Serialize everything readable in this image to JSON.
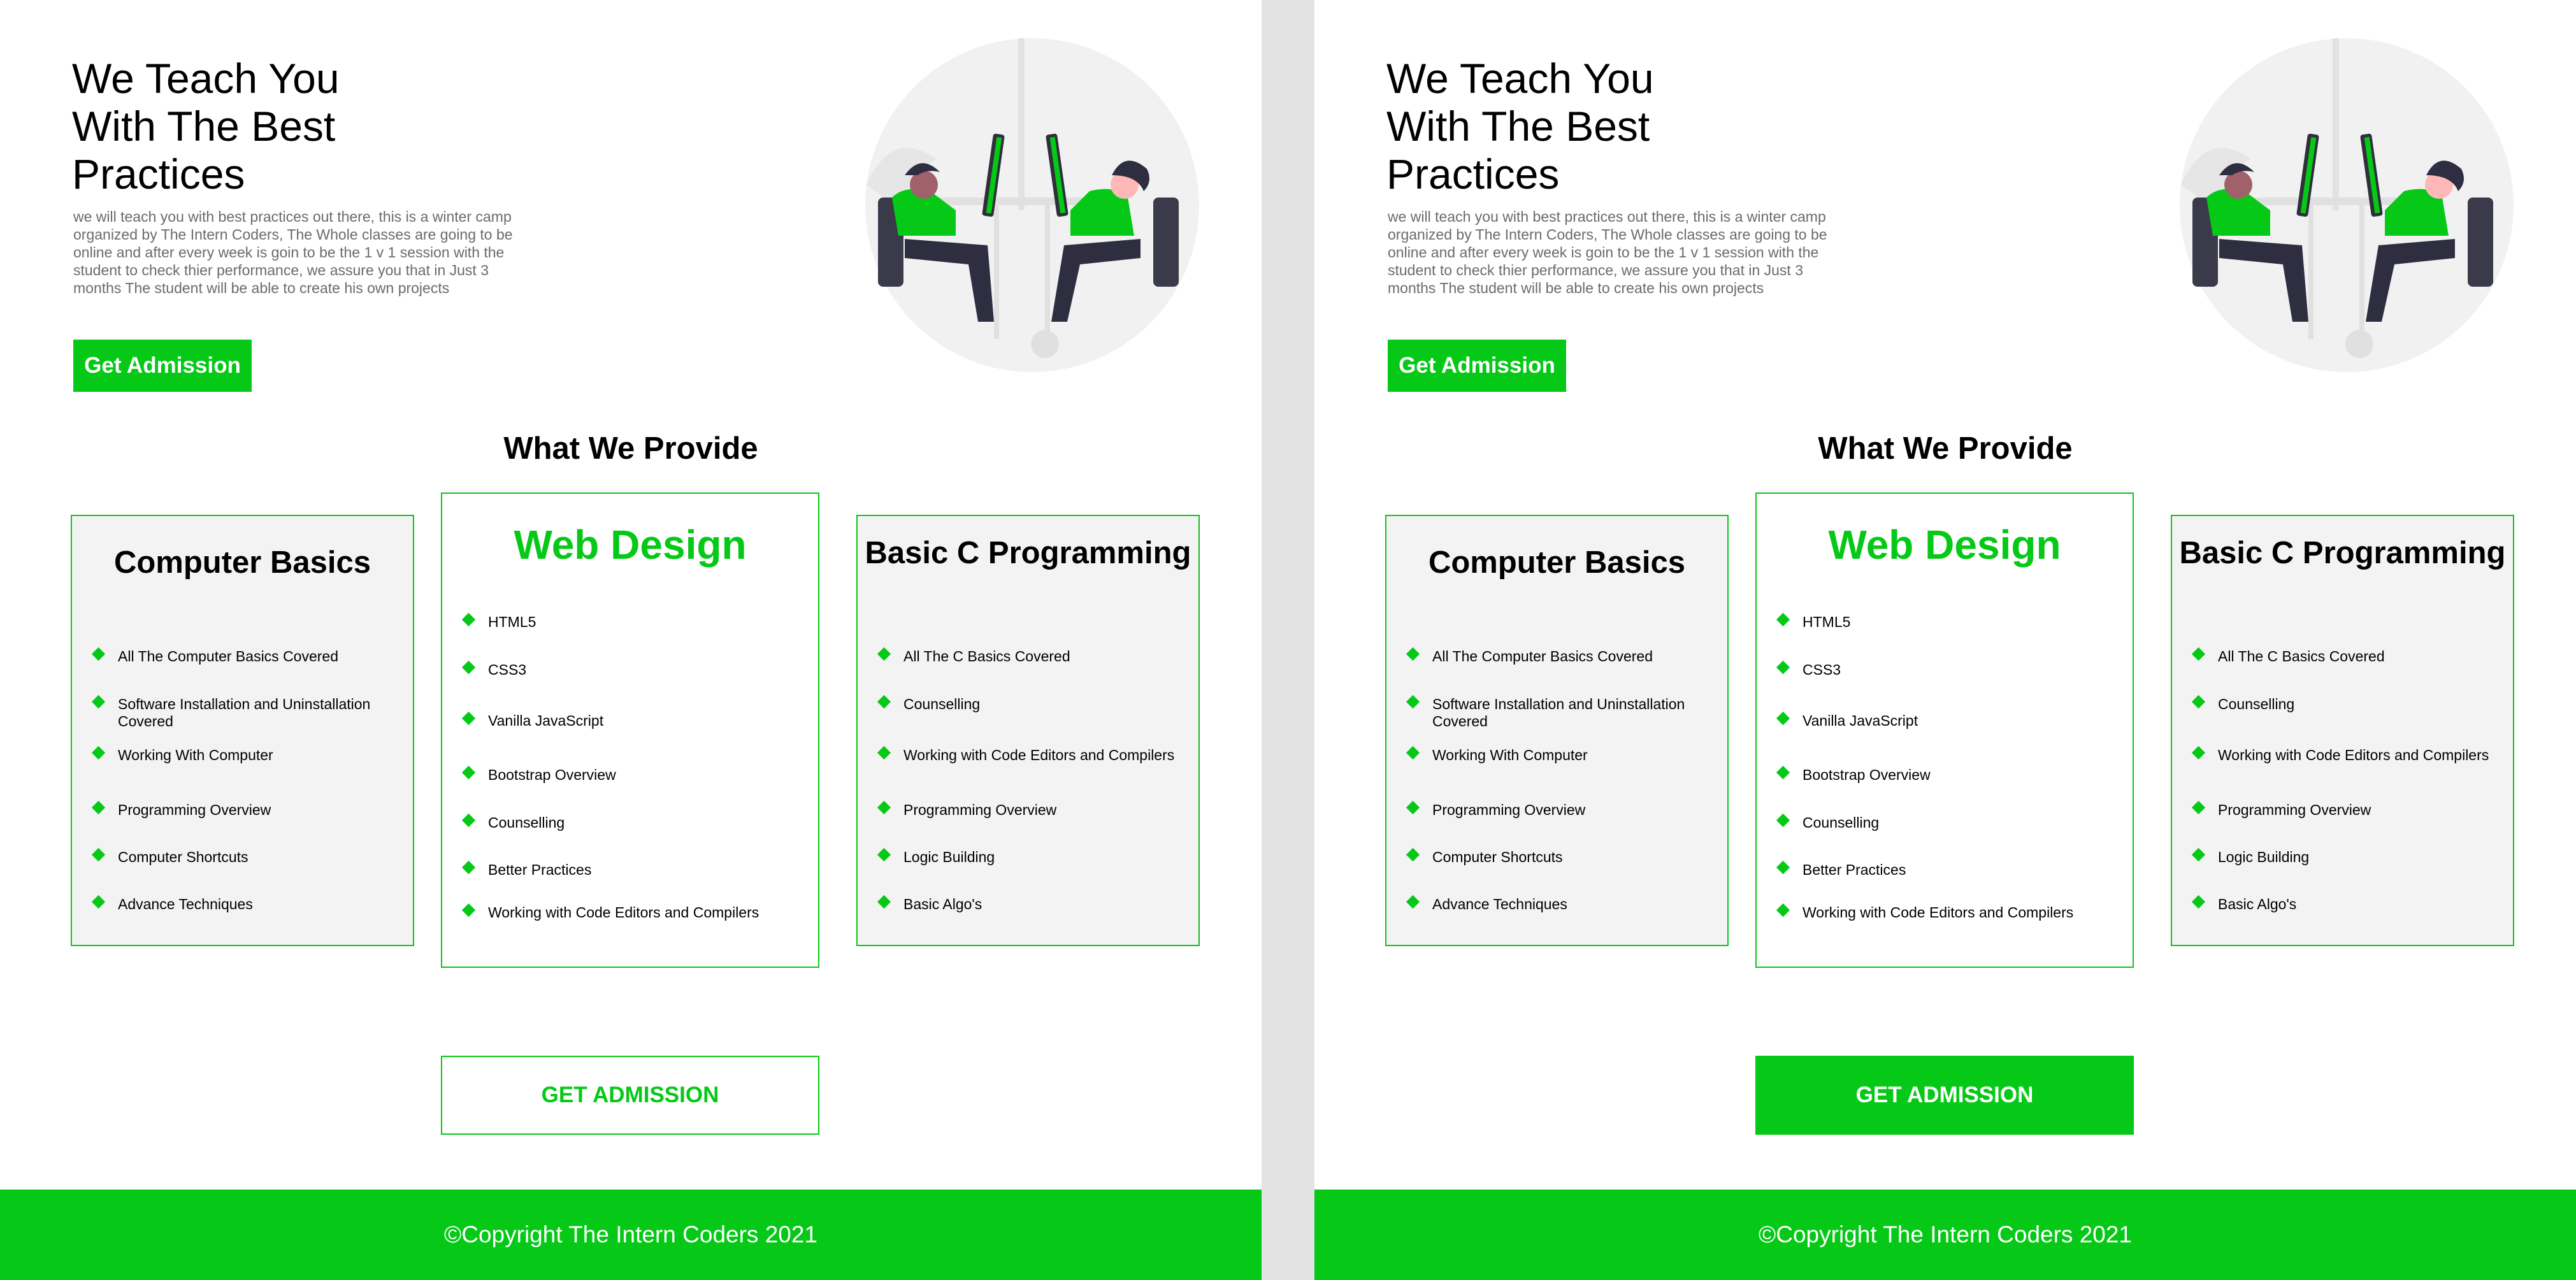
{
  "hero": {
    "title_lines": [
      "We Teach You",
      "With The Best",
      "Practices"
    ],
    "description": "we will teach you with best practices out there, this is a winter camp organized by The Intern Coders, The Whole classes are going to be online and after every week is goin to be the 1 v 1 session with the student to check thier performance, we assure you that in Just 3 months The student will be able to create his own projects",
    "button_label": "Get Admission"
  },
  "section_title": "What We Provide",
  "cards": [
    {
      "title": "Computer Basics",
      "items": [
        "All The Computer Basics Covered",
        "Software Installation and Uninstallation Covered",
        "Working With Computer",
        "Programming Overview",
        "Computer Shortcuts",
        "Advance Techniques"
      ]
    },
    {
      "title": "Web Design",
      "items": [
        "HTML5",
        "CSS3",
        "Vanilla JavaScript",
        "Bootstrap Overview",
        "Counselling",
        "Better Practices",
        "Working with Code Editors and Compilers"
      ]
    },
    {
      "title": "Basic C Programming",
      "items": [
        "All The C Basics Covered",
        "Counselling",
        "Working with Code Editors and Compilers",
        "Programming Overview",
        "Logic Building",
        "Basic Algo's"
      ]
    }
  ],
  "admission_button_label": "GET ADMISSION",
  "footer_text": "©Copyright The Intern Coders 2021",
  "colors": {
    "accent": "#05c916",
    "card_bg": "#f3f3f3",
    "text_muted": "#6b6b6b"
  }
}
